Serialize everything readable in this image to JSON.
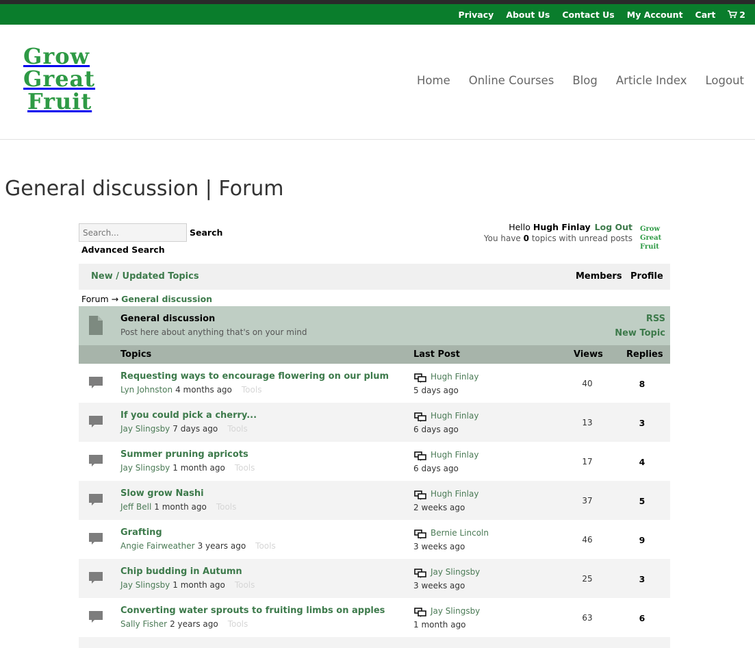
{
  "topbar": {
    "links": [
      "Privacy",
      "About Us",
      "Contact Us",
      "My Account",
      "Cart"
    ],
    "cart_count": "2"
  },
  "logo": {
    "lines": [
      "Grow",
      "Great",
      "Fruit"
    ]
  },
  "mainnav": [
    "Home",
    "Online Courses",
    "Blog",
    "Article Index",
    "Logout"
  ],
  "page_title": "General discussion | Forum",
  "search": {
    "placeholder": "Search...",
    "button": "Search",
    "advanced": "Advanced Search"
  },
  "user": {
    "hello": "Hello",
    "name": "Hugh Finlay",
    "logout": "Log Out",
    "unread_prefix": "You have",
    "unread_count": "0",
    "unread_suffix": "topics with unread posts"
  },
  "forum_nav": {
    "new_topics": "New / Updated Topics",
    "members": "Members",
    "profile": "Profile"
  },
  "breadcrumb": {
    "root": "Forum",
    "arrow": "→",
    "current": "General discussion"
  },
  "forum": {
    "name": "General discussion",
    "description": "Post here about anything that's on your mind",
    "rss": "RSS",
    "new_topic": "New Topic"
  },
  "columns": {
    "topics": "Topics",
    "last_post": "Last Post",
    "views": "Views",
    "replies": "Replies"
  },
  "topics": [
    {
      "title": "Requesting ways to encourage flowering on our plum",
      "author": "Lyn Johnston",
      "ago": "4 months ago",
      "tools": "Tools",
      "last_user": "Hugh Finlay",
      "last_time": "5 days ago",
      "views": "40",
      "replies": "8"
    },
    {
      "title": "If you could pick a cherry...",
      "author": "Jay Slingsby",
      "ago": "7 days ago",
      "tools": "Tools",
      "last_user": "Hugh Finlay",
      "last_time": "6 days ago",
      "views": "13",
      "replies": "3"
    },
    {
      "title": "Summer pruning apricots",
      "author": "Jay Slingsby",
      "ago": "1 month ago",
      "tools": "Tools",
      "last_user": "Hugh Finlay",
      "last_time": "6 days ago",
      "views": "17",
      "replies": "4"
    },
    {
      "title": "Slow grow Nashi",
      "author": "Jeff Bell",
      "ago": "1 month ago",
      "tools": "Tools",
      "last_user": "Hugh Finlay",
      "last_time": "2 weeks ago",
      "views": "37",
      "replies": "5"
    },
    {
      "title": "Grafting",
      "author": "Angie Fairweather",
      "ago": "3 years ago",
      "tools": "Tools",
      "last_user": "Bernie Lincoln",
      "last_time": "3 weeks ago",
      "views": "46",
      "replies": "9"
    },
    {
      "title": "Chip budding in Autumn",
      "author": "Jay Slingsby",
      "ago": "1 month ago",
      "tools": "Tools",
      "last_user": "Jay Slingsby",
      "last_time": "3 weeks ago",
      "views": "25",
      "replies": "3"
    },
    {
      "title": "Converting water sprouts to fruiting limbs on apples",
      "author": "Sally Fisher",
      "ago": "2 years ago",
      "tools": "Tools",
      "last_user": "Jay Slingsby",
      "last_time": "1 month ago",
      "views": "63",
      "replies": "6"
    }
  ],
  "colors": {
    "topbar": "#0a7d2c",
    "link_green": "#3d7a4b",
    "forum_header": "#bfcec4",
    "column_header": "#a7b4aa"
  },
  "icons": {
    "cart": "cart-icon",
    "forum": "document-icon",
    "topic": "speech-bubble-icon",
    "last_post": "last-post-icon"
  }
}
